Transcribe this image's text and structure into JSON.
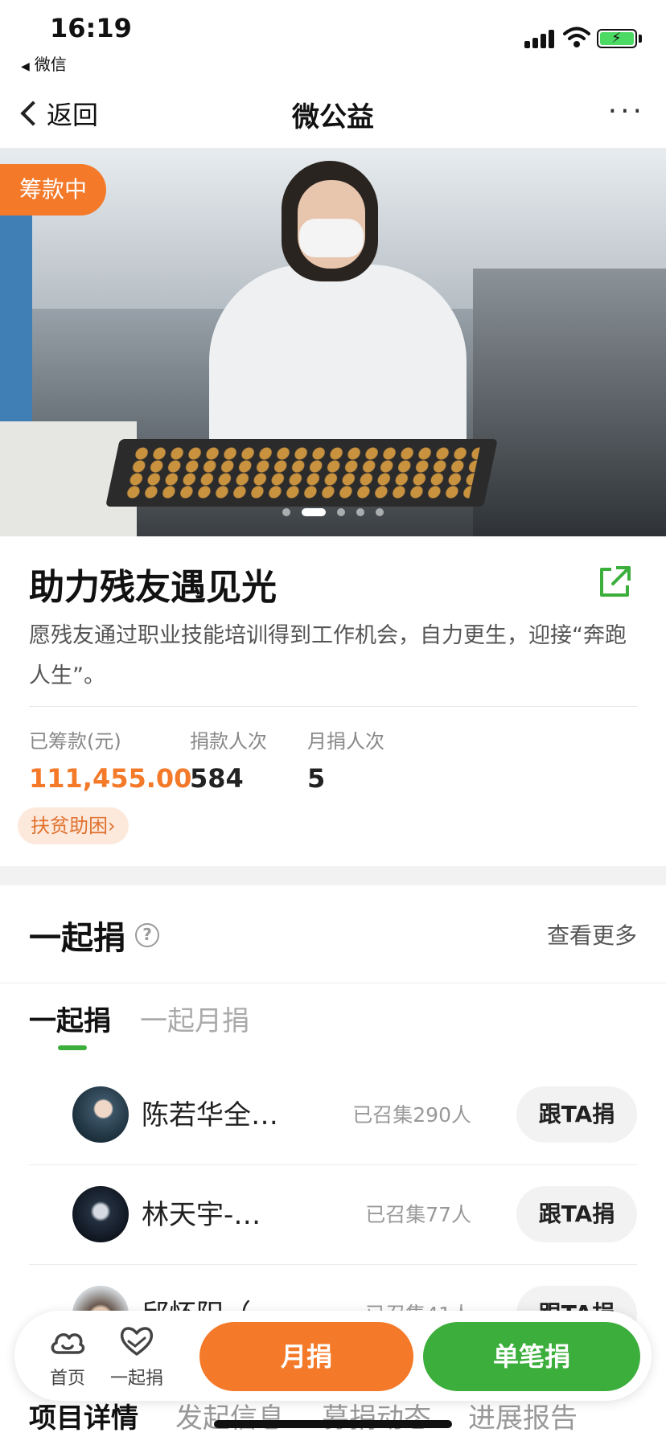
{
  "status_bar": {
    "time": "16:19",
    "back_app": "微信"
  },
  "nav": {
    "back_label": "返回",
    "title": "微公益",
    "more": "···"
  },
  "hero": {
    "status_badge": "筹款中",
    "carousel_total": 5,
    "carousel_active": 2
  },
  "project": {
    "title": "助力残友遇见光",
    "description": "愿残友通过职业技能培训得到工作机会，自力更生，迎接“奔跑人生”。",
    "stats": [
      {
        "label": "已筹款(元)",
        "value": "111,455.00"
      },
      {
        "label": "捐款人次",
        "value": "584"
      },
      {
        "label": "月捐人次",
        "value": "5"
      }
    ],
    "tag": "扶贫助困›"
  },
  "together": {
    "title": "一起捐",
    "see_more": "查看更多",
    "tabs": [
      "一起捐",
      "一起月捐"
    ],
    "rows": [
      {
        "name": "陈若华全…",
        "count": "已召集290人",
        "button": "跟TA捐"
      },
      {
        "name": "林天宇-…",
        "count": "已召集77人",
        "button": "跟TA捐"
      },
      {
        "name": "邱怀阳（",
        "count": "已召集41人",
        "button": "跟TA捐"
      }
    ]
  },
  "action_bar": {
    "home": "首页",
    "together": "一起捐",
    "monthly": "月捐",
    "single": "单笔捐"
  },
  "bottom_tabs": [
    "项目详情",
    "发起信息",
    "募捐动态",
    "进展报告"
  ],
  "colors": {
    "orange": "#f47a2a",
    "green": "#3cae3c"
  }
}
